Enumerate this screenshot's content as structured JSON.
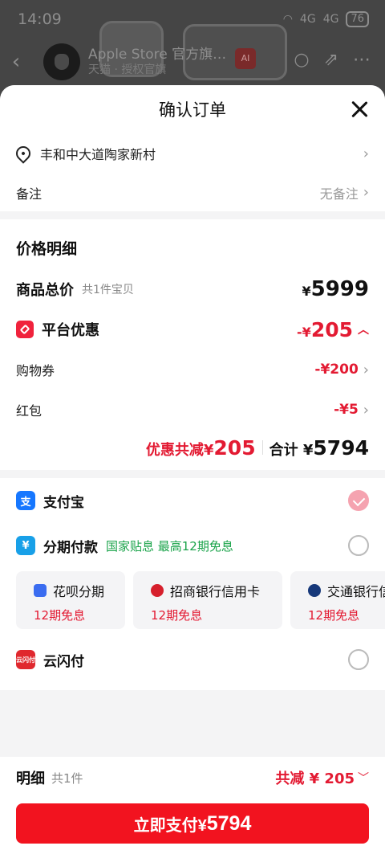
{
  "status_bar": {
    "time": "14:09",
    "network": "4G",
    "network2": "4G",
    "battery": "76"
  },
  "background": {
    "store_name": "Apple Store 官方旗…",
    "store_sub": "天猫 · 授权官旗",
    "ai_badge": "AI"
  },
  "sheet": {
    "title": "确认订单"
  },
  "address": {
    "text": "丰和中大道陶家新村"
  },
  "remark": {
    "label": "备注",
    "value": "无备注"
  },
  "price": {
    "title": "价格明细",
    "goods_label": "商品总价",
    "goods_sub": "共1件宝贝",
    "goods_currency": "¥",
    "goods_amount": "5999",
    "platform_label": "平台优惠",
    "platform_prefix": "-¥",
    "platform_amount": "205",
    "coupon_label": "购物券",
    "coupon_value": "-¥200",
    "redpacket_label": "红包",
    "redpacket_value": "-¥5",
    "save_label": "优惠共减",
    "save_currency": "¥",
    "save_amount": "205",
    "total_label": "合计",
    "total_currency": "¥",
    "total_amount": "5794"
  },
  "payment": {
    "alipay_label": "支付宝",
    "installment_label": "分期付款",
    "installment_promo": "国家贴息 最高12期免息",
    "banks": [
      {
        "name": "花呗分期",
        "free": "12期免息"
      },
      {
        "name": "招商银行信用卡",
        "free": "12期免息"
      },
      {
        "name": "交通银行信用卡",
        "free": "12期免息"
      }
    ],
    "unionpay_label": "云闪付",
    "unionpay_icon_text": "云闪付"
  },
  "bottom": {
    "detail_label": "明细",
    "detail_count": "共1件",
    "save_text": "共减 ¥ 205",
    "pay_label": "立即支付¥",
    "pay_amount": "5794"
  },
  "colors": {
    "accent_red": "#f2131f",
    "price_red": "#e31a32",
    "promo_green": "#1aa34a",
    "alipay_blue": "#1677ff"
  },
  "icons": [
    "pin-icon",
    "chevron-right-icon",
    "close-icon",
    "tag-icon",
    "chevron-up-icon",
    "alipay-icon",
    "installment-icon",
    "unionpay-icon",
    "check-icon",
    "chevron-down-icon"
  ]
}
